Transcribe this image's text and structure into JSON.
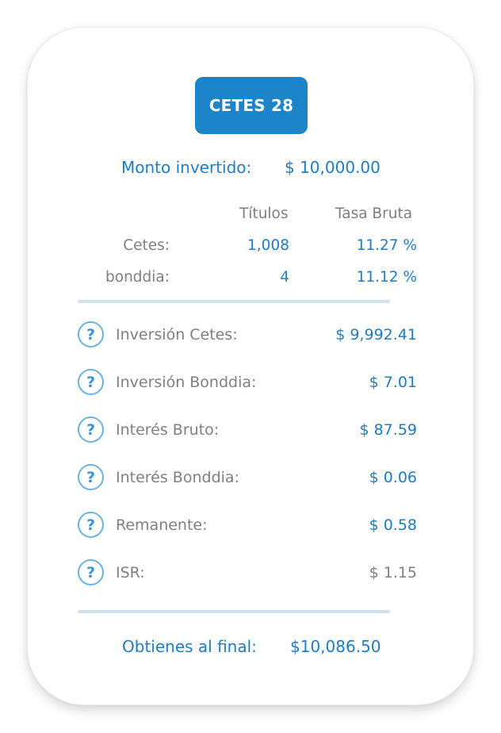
{
  "header": {
    "instrument_label": "CETES 28"
  },
  "investment": {
    "label": "Monto invertido:",
    "value": "$ 10,000.00"
  },
  "table": {
    "columns": [
      "Títulos",
      "Tasa Bruta"
    ],
    "rows": [
      {
        "label": "Cetes:",
        "titulos": "1,008",
        "tasa": "11.27 %"
      },
      {
        "label": "bonddia:",
        "titulos": "4",
        "tasa": "11.12 %"
      }
    ]
  },
  "details": [
    {
      "label": "Inversión Cetes:",
      "value": "$ 9,992.41",
      "value_color": "blue"
    },
    {
      "label": "Inversión Bonddia:",
      "value": "$ 7.01",
      "value_color": "blue"
    },
    {
      "label": "Interés Bruto:",
      "value": "$ 87.59",
      "value_color": "blue"
    },
    {
      "label": "Interés Bonddia:",
      "value": "$ 0.06",
      "value_color": "blue"
    },
    {
      "label": "Remanente:",
      "value": "$ 0.58",
      "value_color": "blue"
    },
    {
      "label": "ISR:",
      "value": "$ 1.15",
      "value_color": "gray"
    }
  ],
  "help_icon_glyph": "?",
  "total": {
    "label": "Obtienes al final:",
    "value": "$10,086.50"
  },
  "colors": {
    "accent": "#1e84c8",
    "text_blue": "#1f7cc2",
    "text_gray": "#7f7f7f",
    "divider": "#cde2ee"
  }
}
